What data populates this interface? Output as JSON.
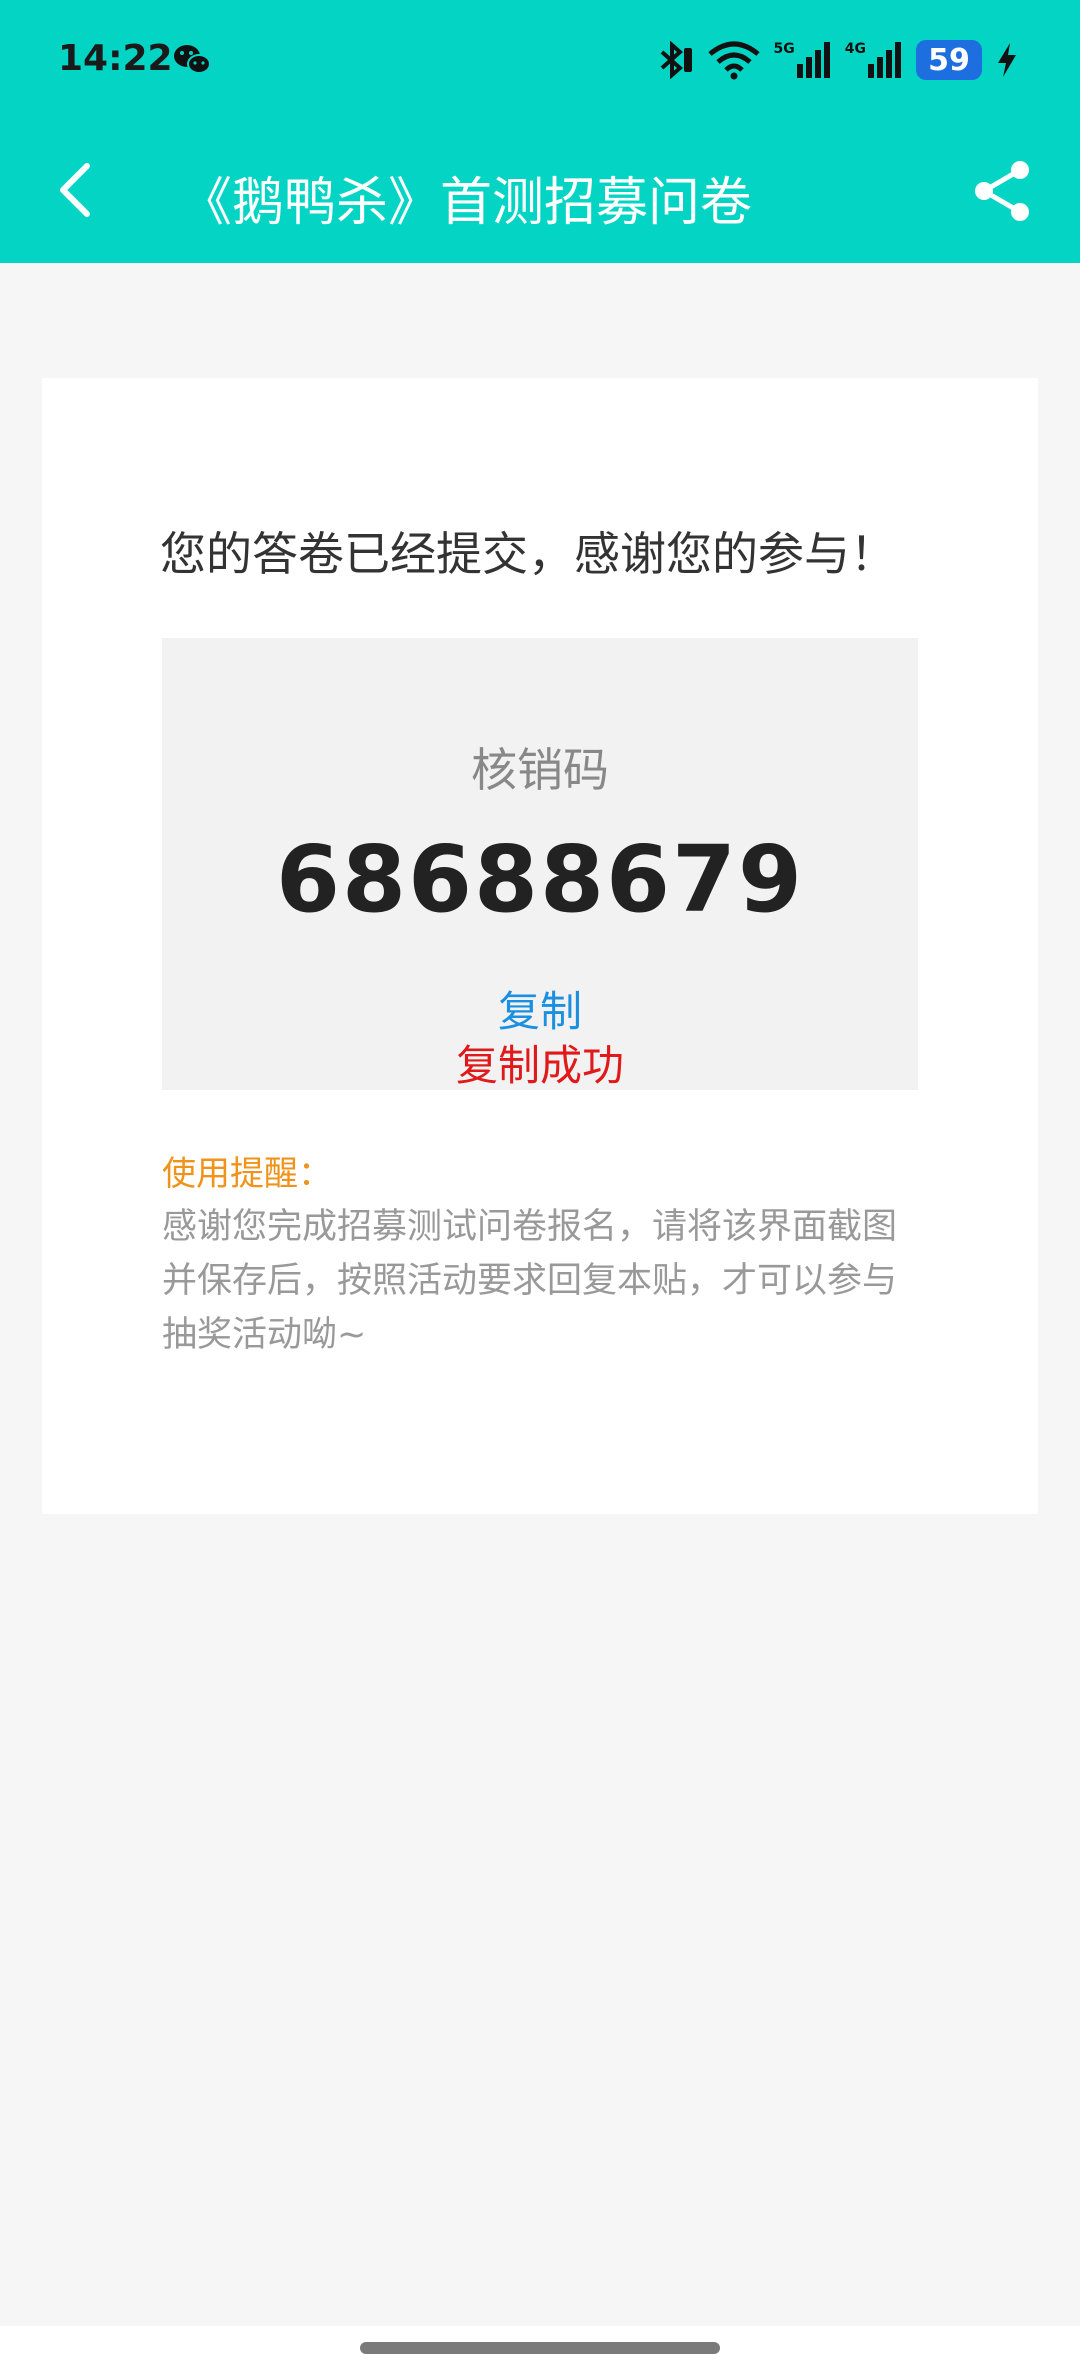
{
  "status_bar": {
    "time": "14:22",
    "network_5g": "5G",
    "network_4g": "4G",
    "battery": "59"
  },
  "navbar": {
    "title": "《鹅鸭杀》首测招募问卷"
  },
  "card": {
    "headline": "您的答卷已经提交，感谢您的参与！",
    "code_label": "核销码",
    "code_value": "68688679",
    "copy_label": "复制",
    "copy_success": "复制成功",
    "tip_title": "使用提醒：",
    "tip_body": "感谢您完成招募测试问卷报名，请将该界面截图并保存后，按照活动要求回复本贴，才可以参与抽奖活动呦~"
  },
  "colors": {
    "header_bg": "#03d4c4",
    "copy_link": "#1b8fe0",
    "success": "#e01a1a",
    "tip_title": "#f0931a"
  }
}
